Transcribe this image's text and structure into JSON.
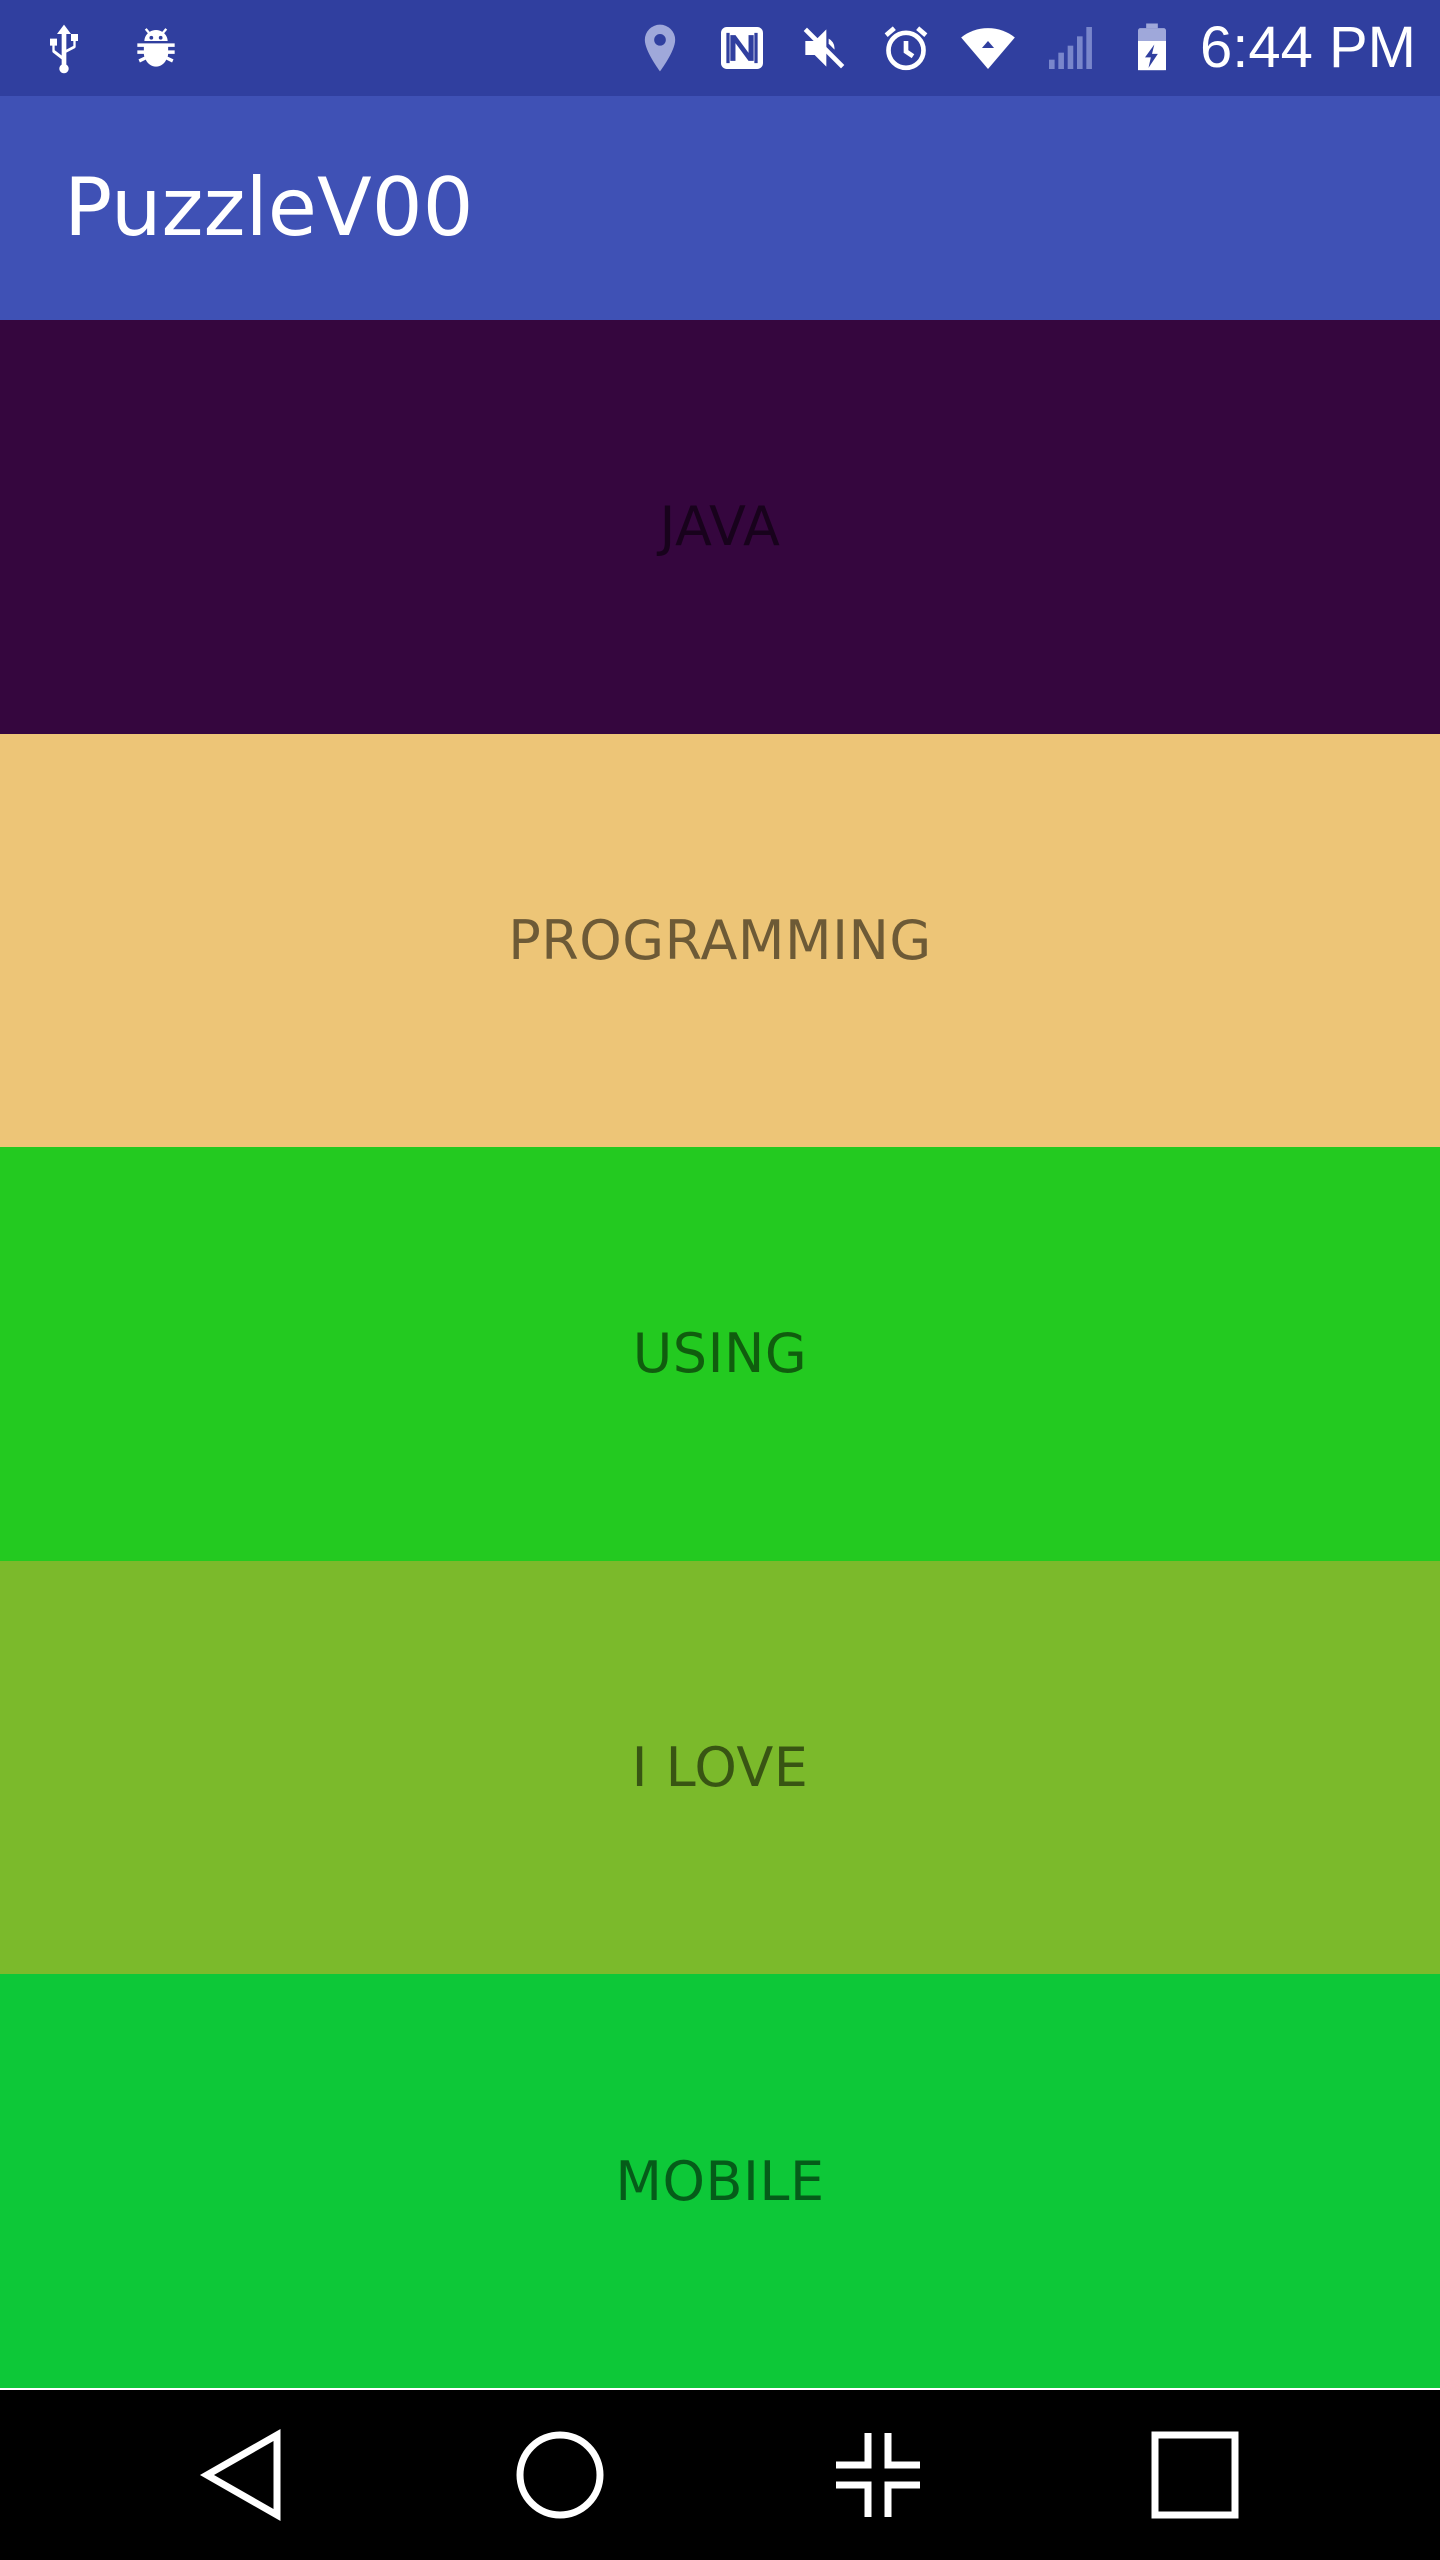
{
  "status_bar": {
    "time": "6:44 PM",
    "left_icons": [
      "usb-icon",
      "android-debug-icon"
    ],
    "right_icons": [
      "location-icon",
      "nfc-icon",
      "mute-icon",
      "alarm-icon",
      "wifi-icon",
      "cell-signal-icon",
      "battery-charging-icon"
    ],
    "background": "#303F9F"
  },
  "app_bar": {
    "title": "PuzzleV00",
    "background": "#3F51B5"
  },
  "puzzle_rows": [
    {
      "label": "JAVA",
      "color": "#35063E"
    },
    {
      "label": "PROGRAMMING",
      "color": "#EDC577"
    },
    {
      "label": "USING",
      "color": "#23CA20"
    },
    {
      "label": "I LOVE",
      "color": "#7BBA2B"
    },
    {
      "label": "MOBILE",
      "color": "#0DC838"
    }
  ],
  "nav_bar": {
    "buttons": [
      "back-icon",
      "home-icon",
      "dual-window-icon",
      "recents-icon"
    ]
  }
}
